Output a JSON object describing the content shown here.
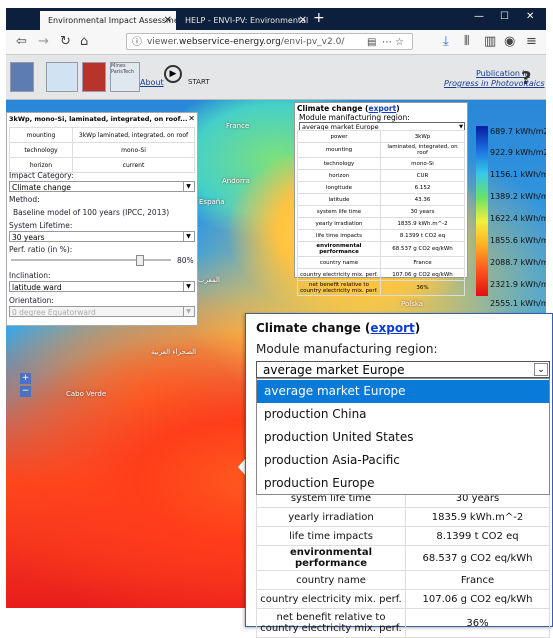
{
  "browser": {
    "tabs": [
      {
        "label": "Environmental Impact Assessment"
      },
      {
        "label": "HELP - ENVI-PV: Environmental Impac"
      }
    ],
    "url_prefix": "viewer.",
    "url_domain": "webservice-energy.org",
    "url_path": "/envi-pv_v2.0/"
  },
  "app": {
    "about_label": "About",
    "start_label": "START",
    "publication_line1": "Publication in",
    "publication_line2": "Progress in Photovoltaics",
    "help_label": "?",
    "logo_text": "Mines ParisTech"
  },
  "map_labels": {
    "france": "France",
    "andorra": "Andorra",
    "espana": "España",
    "morocco_ar": "المغرب",
    "morocco_ar2": "الصحراء الغربية",
    "western_sahara": "الصحراء الغربية",
    "sahara_ar": "الصحراء الغربية",
    "cabo_verde": "Cabo Verde",
    "polska": "Polska"
  },
  "left_panel": {
    "title": "3kWp, mono-Si, laminated, integrated, on roof...",
    "rows": [
      {
        "k": "mounting",
        "v": "3kWp laminated, integrated, on roof"
      },
      {
        "k": "technology",
        "v": "mono-Si"
      },
      {
        "k": "horizon",
        "v": "current"
      }
    ],
    "impact_label": "Impact Category:",
    "impact_value": "Climate change",
    "method_label": "Method:",
    "method_value": "Baseline model of 100 years (IPCC, 2013)",
    "lifetime_label": "System Lifetime:",
    "lifetime_value": "30 years",
    "perf_label": "Perf. ratio (in %):",
    "perf_value": "80%",
    "perf_ratio": 0.8,
    "inclination_label": "Inclination:",
    "inclination_value": "latitude ward",
    "orientation_label": "Orientation:",
    "orientation_value": "0 degree Equatorward"
  },
  "popup_small": {
    "title_prefix": "Climate change (",
    "title_link": "export",
    "title_suffix": ")",
    "region_label": "Module manifacturing region:",
    "region_value": "average market Europe",
    "rows": [
      {
        "k": "power",
        "v": "3kWp"
      },
      {
        "k": "mounting",
        "v": "laminated, integrated, on roof"
      },
      {
        "k": "technology",
        "v": "mono-Si"
      },
      {
        "k": "horizon",
        "v": "CUR"
      },
      {
        "k": "longitude",
        "v": "6.152"
      },
      {
        "k": "latitude",
        "v": "43.36"
      },
      {
        "k": "system life time",
        "v": "30 years"
      },
      {
        "k": "yearly irradiation",
        "v": "1835.9 kWh.m^-2"
      },
      {
        "k": "life time impacts",
        "v": "8.1399 t CO2 eq"
      },
      {
        "k": "environmental performance",
        "v": "68.537 g CO2 eq/kWh"
      },
      {
        "k": "country name",
        "v": "France"
      },
      {
        "k": "country electricity mix. perf.",
        "v": "107.06 g CO2 eq/kWh"
      },
      {
        "k": "net benefit relative to country electricity mix. perf.",
        "v": "36%"
      }
    ]
  },
  "legend": {
    "labels": [
      "689.7 kWh/m2",
      "922.9 kWh/m2",
      "1156.1 kWh/m2",
      "1389.2 kWh/m2",
      "1622.4 kWh/m2",
      "1855.6 kWh/m2",
      "2088.7 kWh/m2",
      "2321.9 kWh/m2",
      "2555.1 kWh/m2"
    ]
  },
  "zoom": {
    "in": "+",
    "out": "−"
  },
  "popup_large": {
    "title_prefix": "Climate change (",
    "title_link": "export",
    "title_suffix": ")",
    "region_label": "Module manufacturing region:",
    "region_value": "average market Europe",
    "options": [
      "average market Europe",
      "production China",
      "production United States",
      "production Asia-Pacific",
      "production Europe"
    ],
    "rows": [
      {
        "k": "system life time",
        "v": "30 years"
      },
      {
        "k": "yearly irradiation",
        "v": "1835.9 kWh.m^-2"
      },
      {
        "k": "life time impacts",
        "v": "8.1399 t CO2 eq"
      },
      {
        "k": "environmental performance",
        "v": "68.537 g CO2 eq/kWh"
      },
      {
        "k": "country name",
        "v": "France"
      },
      {
        "k": "country electricity mix. perf.",
        "v": "107.06 g CO2 eq/kWh"
      },
      {
        "k": "net benefit relative to country electricity mix. perf.",
        "v": "36%"
      }
    ]
  }
}
